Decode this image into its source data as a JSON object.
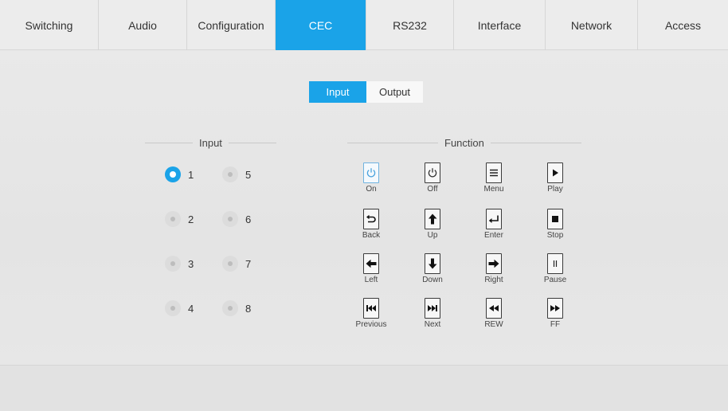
{
  "nav": {
    "tabs": [
      {
        "label": "Switching"
      },
      {
        "label": "Audio"
      },
      {
        "label": "Configuration"
      },
      {
        "label": "CEC",
        "active": true
      },
      {
        "label": "RS232"
      },
      {
        "label": "Interface"
      },
      {
        "label": "Network"
      },
      {
        "label": "Access"
      }
    ]
  },
  "mode_toggle": {
    "input_label": "Input",
    "output_label": "Output",
    "selected": "Input"
  },
  "input_section": {
    "title": "Input",
    "options": [
      "1",
      "2",
      "3",
      "4",
      "5",
      "6",
      "7",
      "8"
    ],
    "selected": "1"
  },
  "function_section": {
    "title": "Function",
    "buttons": [
      {
        "label": "On",
        "icon": "power-icon"
      },
      {
        "label": "Off",
        "icon": "power-icon"
      },
      {
        "label": "Menu",
        "icon": "menu-icon"
      },
      {
        "label": "Play",
        "icon": "play-icon"
      },
      {
        "label": "Back",
        "icon": "back-arrow-icon"
      },
      {
        "label": "Up",
        "icon": "arrow-up-icon"
      },
      {
        "label": "Enter",
        "icon": "enter-icon"
      },
      {
        "label": "Stop",
        "icon": "stop-icon"
      },
      {
        "label": "Left",
        "icon": "arrow-left-icon"
      },
      {
        "label": "Down",
        "icon": "arrow-down-icon"
      },
      {
        "label": "Right",
        "icon": "arrow-right-icon"
      },
      {
        "label": "Pause",
        "icon": "pause-icon"
      },
      {
        "label": "Previous",
        "icon": "skip-previous-icon"
      },
      {
        "label": "Next",
        "icon": "skip-next-icon"
      },
      {
        "label": "REW",
        "icon": "rewind-icon"
      },
      {
        "label": "FF",
        "icon": "fast-forward-icon"
      }
    ],
    "highlighted": "On"
  },
  "colors": {
    "accent": "#1aa3e8",
    "background": "#e7e7e7"
  }
}
